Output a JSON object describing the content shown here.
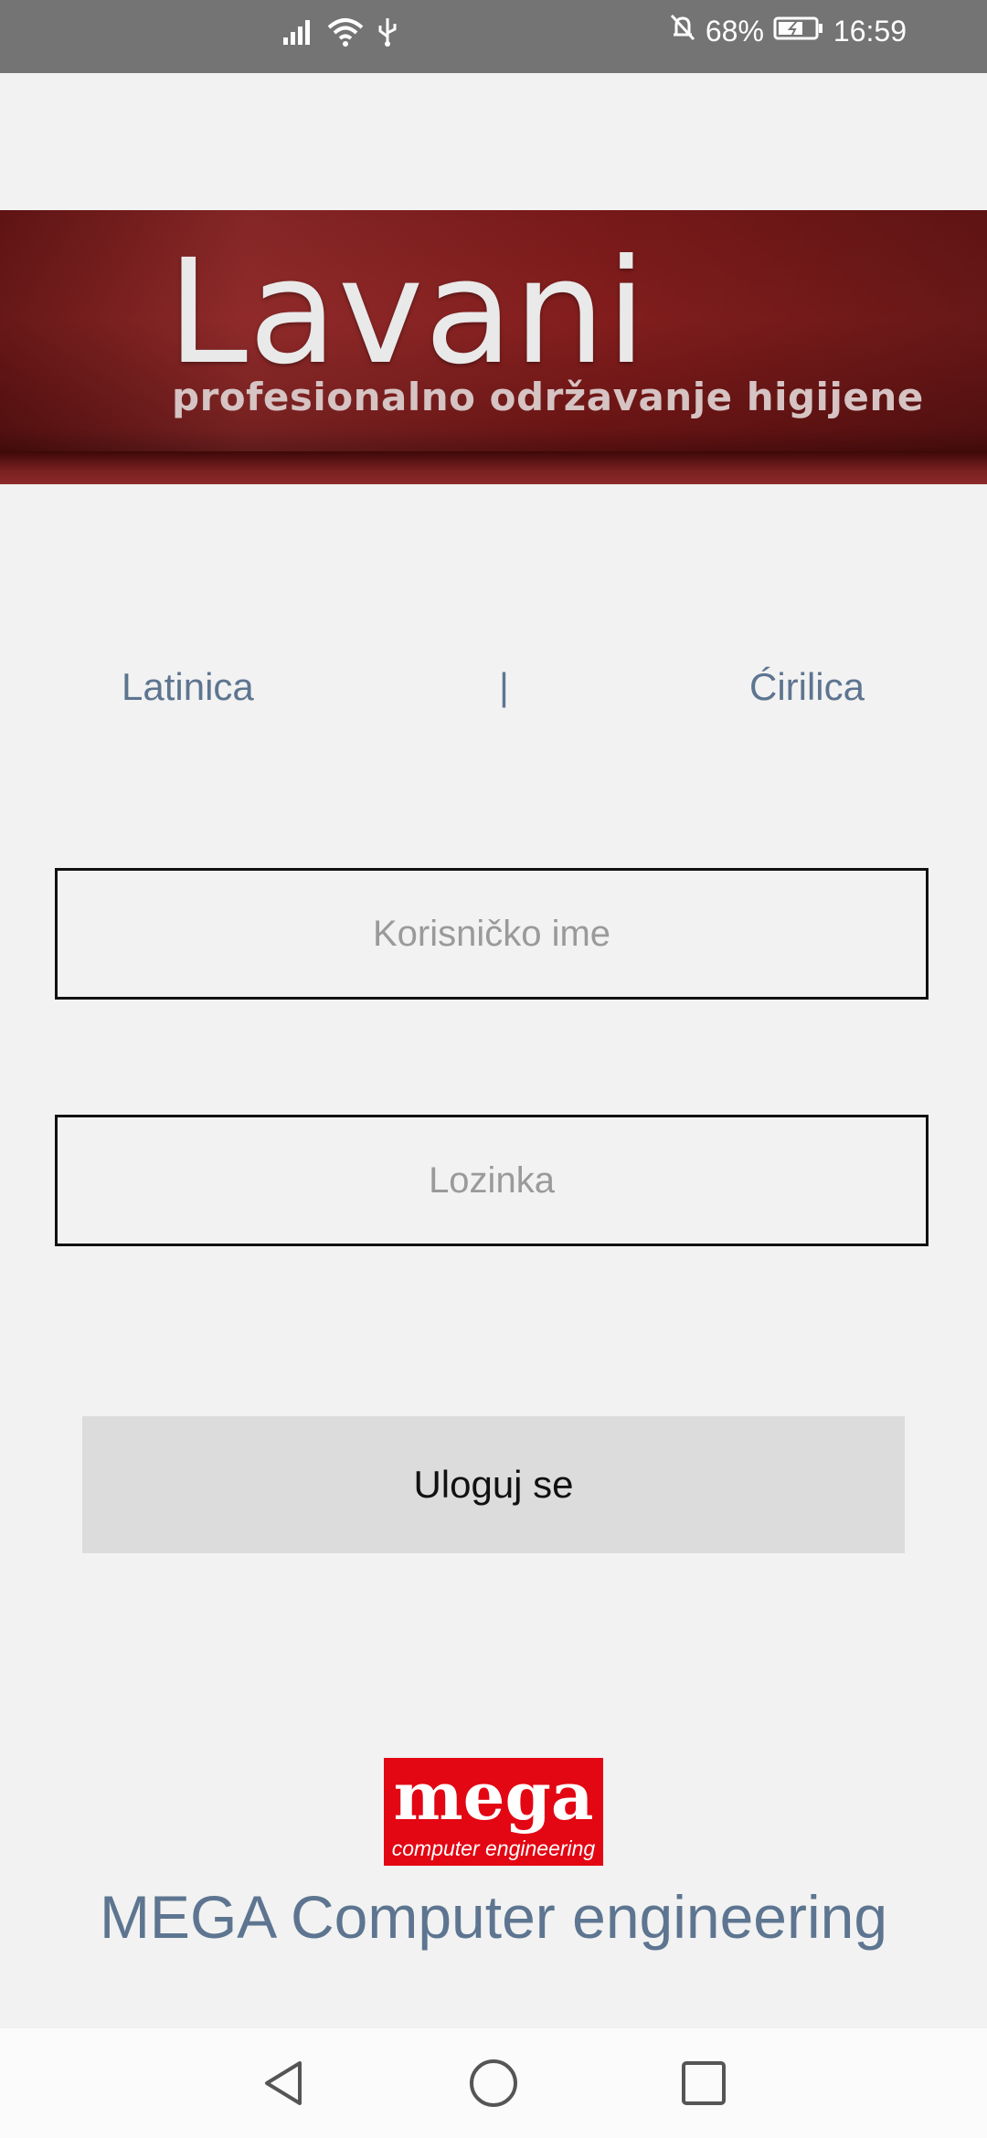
{
  "status_bar": {
    "battery_percent": "68%",
    "time": "16:59",
    "icons": [
      "signal-icon",
      "wifi-icon",
      "usb-icon",
      "mute-bell-icon",
      "battery-charging-icon"
    ]
  },
  "banner": {
    "brand": "Lavani",
    "tagline": "profesionalno održavanje higijene"
  },
  "language": {
    "latin": "Latinica",
    "separator": "|",
    "cyrillic": "Ćirilica"
  },
  "form": {
    "username_placeholder": "Korisničko ime",
    "username_value": "",
    "password_placeholder": "Lozinka",
    "password_value": "",
    "login_label": "Uloguj se"
  },
  "footer": {
    "logo_word": "mega",
    "logo_sub": "computer engineering",
    "company": "MEGA Computer engineering"
  },
  "colors": {
    "link": "#5d7590",
    "banner": "#7e1a1a",
    "logo": "#e30613"
  }
}
